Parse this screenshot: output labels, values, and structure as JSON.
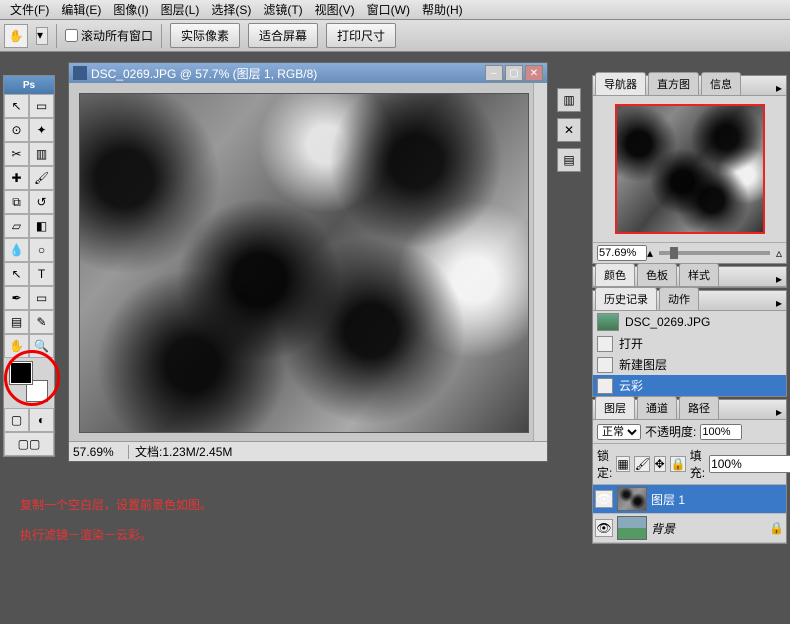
{
  "menu": {
    "file": "文件(F)",
    "edit": "编辑(E)",
    "image": "图像(I)",
    "layer": "图层(L)",
    "select": "选择(S)",
    "filter": "滤镜(T)",
    "view": "视图(V)",
    "window": "窗口(W)",
    "help": "帮助(H)"
  },
  "options": {
    "scroll_all": "滚动所有窗口",
    "actual_pixels": "实际像素",
    "fit_screen": "适合屏幕",
    "print_size": "打印尺寸"
  },
  "document": {
    "title": "DSC_0269.JPG @ 57.7% (图层 1, RGB/8)",
    "zoom": "57.69%",
    "doc_info_label": "文档:",
    "doc_info": "1.23M/2.45M"
  },
  "toolbox": {
    "ps_label": "Ps"
  },
  "navigator": {
    "tab_nav": "导航器",
    "tab_histogram": "直方图",
    "tab_info": "信息",
    "zoom": "57.69%"
  },
  "color_panel": {
    "tab_color": "颜色",
    "tab_swatches": "色板",
    "tab_styles": "样式"
  },
  "history_panel": {
    "tab_history": "历史记录",
    "tab_actions": "动作",
    "items": [
      {
        "label": "DSC_0269.JPG"
      },
      {
        "label": "打开"
      },
      {
        "label": "新建图层"
      },
      {
        "label": "云彩"
      }
    ]
  },
  "layers_panel": {
    "tab_layers": "图层",
    "tab_channels": "通道",
    "tab_paths": "路径",
    "blend_mode": "正常",
    "opacity_label": "不透明度:",
    "opacity_value": "100%",
    "lock_label": "锁定:",
    "fill_label": "填充:",
    "fill_value": "100%",
    "layers": [
      {
        "name": "图层 1"
      },
      {
        "name": "背景"
      }
    ]
  },
  "instructions": {
    "line1": "复制一个空白层，设置前景色如图。",
    "line2": "执行滤镜－渲染－云彩。"
  }
}
